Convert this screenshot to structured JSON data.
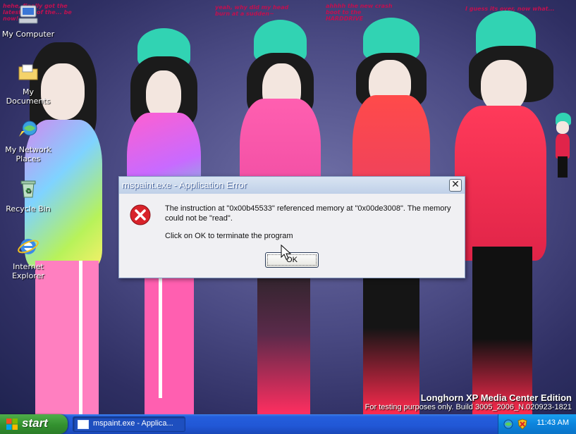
{
  "desktop": {
    "icons": [
      {
        "label": "My Computer",
        "icon": "computer-icon"
      },
      {
        "label": "My Documents",
        "icon": "folder-documents-icon"
      },
      {
        "label": "My Network Places",
        "icon": "network-places-icon"
      },
      {
        "label": "Recycle Bin",
        "icon": "recycle-bin-icon"
      },
      {
        "label": "Internet Explorer",
        "icon": "internet-explorer-icon"
      }
    ],
    "watermark": {
      "line1": "Longhorn XP Media Center Edition",
      "line2": "For testing purposes only. Build 3005_2006_N.020923-1821"
    },
    "wallpaper_scribbles": [
      "hehe, finally got the latest ver. of the... be now!",
      "yeah, why did my head burn at a sudden~",
      "ahhhh the new crash boot to the HARDDRIVE",
      "I guess its over, now what..."
    ]
  },
  "dialog": {
    "title": "mspaint.exe - Application Error",
    "close_label": "✕",
    "message_line1": "The instruction at \"0x00b45533\" referenced memory at \"0x00de3008\". The memory could not be \"read\".",
    "message_line2": "Click on OK to terminate the program",
    "ok_label": "OK",
    "icon": "error-icon"
  },
  "taskbar": {
    "start_label": "start",
    "task_label": "mspaint.exe - Applica...",
    "clock": "11:43 AM"
  },
  "colors": {
    "taskbar_blue": "#245edc",
    "start_green": "#33912f",
    "error_red": "#d8232a",
    "title_bar": "#bfd0e8"
  }
}
